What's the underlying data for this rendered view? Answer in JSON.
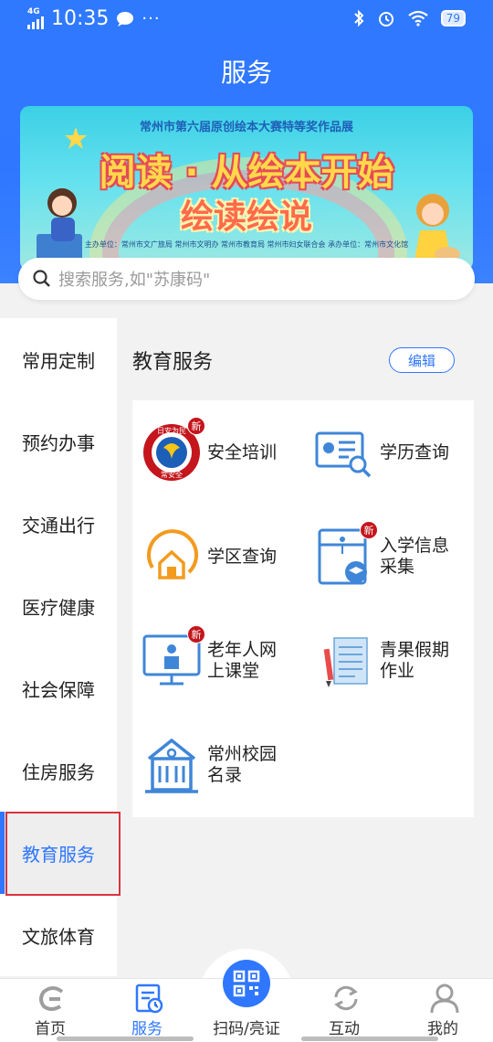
{
  "status_bar": {
    "network": "4G",
    "time": "10:35",
    "battery": "79"
  },
  "header": {
    "title": "服务"
  },
  "banner": {
    "top_line": "常州市第六届原创绘本大赛特等奖作品展",
    "line1": "阅读 · 从绘本开始",
    "line2": "绘读绘说",
    "organizers": "主办单位：常州市文广旅局  常州市文明办  常州市教育局  常州市妇女联合会   承办单位：常州市文化馆"
  },
  "search": {
    "placeholder": "搜索服务,如\"苏康码\""
  },
  "sidebar": {
    "items": [
      {
        "label": "常用定制"
      },
      {
        "label": "预约办事"
      },
      {
        "label": "交通出行"
      },
      {
        "label": "医疗健康"
      },
      {
        "label": "社会保障"
      },
      {
        "label": "住房服务"
      },
      {
        "label": "教育服务"
      },
      {
        "label": "文旅体育"
      }
    ],
    "active": "教育服务"
  },
  "section": {
    "title": "教育服务",
    "edit_label": "编辑"
  },
  "services": [
    {
      "label1": "安全培训",
      "label2": "",
      "icon": "safety-badge-icon",
      "badge": "新"
    },
    {
      "label1": "学历查询",
      "label2": "",
      "icon": "diploma-search-icon",
      "badge": ""
    },
    {
      "label1": "学区查询",
      "label2": "",
      "icon": "school-district-icon",
      "badge": ""
    },
    {
      "label1": "入学信息",
      "label2": "采集",
      "icon": "enrollment-folder-icon",
      "badge": "新"
    },
    {
      "label1": "老年人网",
      "label2": "上课堂",
      "icon": "online-class-icon",
      "badge": "新"
    },
    {
      "label1": "青果假期",
      "label2": "作业",
      "icon": "holiday-homework-icon",
      "badge": ""
    },
    {
      "label1": "常州校园",
      "label2": "名录",
      "icon": "school-building-icon",
      "badge": ""
    }
  ],
  "emblem_text": {
    "top": "日安为民",
    "bottom": "常安全"
  },
  "bottom_nav": {
    "items": [
      {
        "label": "首页",
        "icon": "home-logo-icon"
      },
      {
        "label": "服务",
        "icon": "service-doc-icon"
      },
      {
        "label": "扫码/亮证",
        "icon": "qr-code-icon"
      },
      {
        "label": "互动",
        "icon": "interact-refresh-icon"
      },
      {
        "label": "我的",
        "icon": "profile-icon"
      }
    ],
    "active": "服务"
  },
  "colors": {
    "primary": "#2f77ff",
    "badge_red": "#c4161c",
    "highlight_outline": "#d9333f",
    "icon_blue": "#3f86d8",
    "icon_orange": "#f39b1f"
  }
}
